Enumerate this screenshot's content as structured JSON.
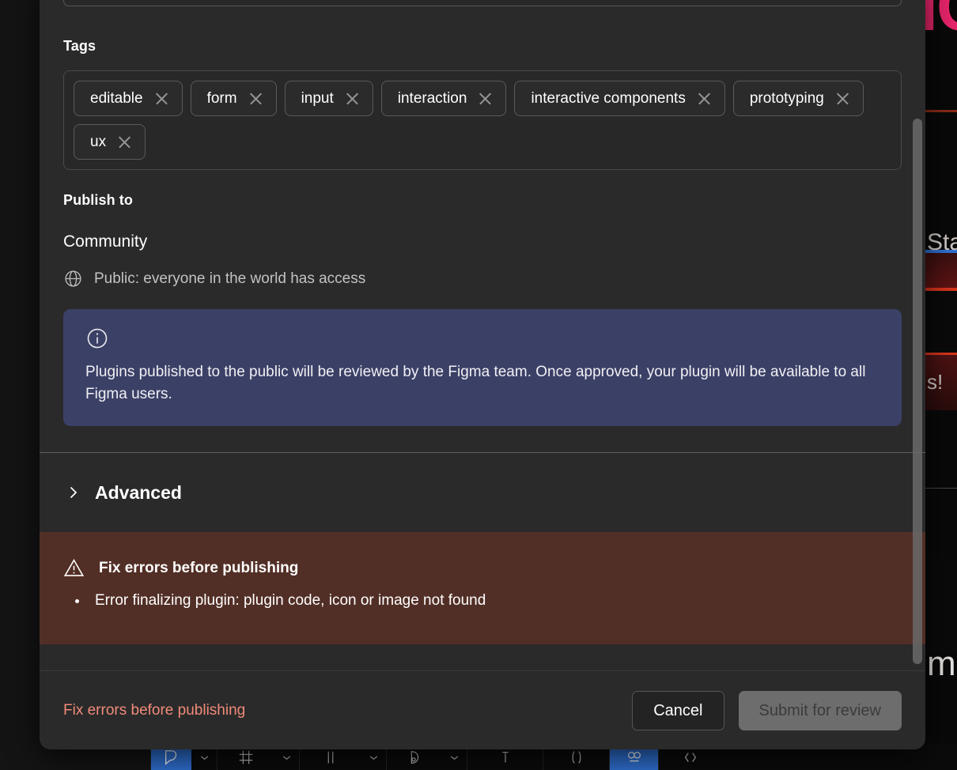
{
  "modal": {
    "tags": {
      "label": "Tags",
      "items": [
        {
          "name": "editable"
        },
        {
          "name": "form"
        },
        {
          "name": "input"
        },
        {
          "name": "interaction"
        },
        {
          "name": "interactive components"
        },
        {
          "name": "prototyping"
        },
        {
          "name": "ux"
        }
      ],
      "remove_icon": "close-x-icon"
    },
    "publish_to": {
      "label": "Publish to",
      "destination": "Community",
      "visibility_icon": "globe-icon",
      "visibility": "Public: everyone in the world has access"
    },
    "info_banner": {
      "icon": "info-circle-icon",
      "text": "Plugins published to the public will be reviewed by the Figma team. Once approved, your plugin will be available to all Figma users.",
      "bg_color": "#3b4066",
      "text_color": "#f0f0f4"
    },
    "advanced": {
      "label": "Advanced",
      "chevron_icon": "chevron-right-icon",
      "expanded": false
    },
    "error_banner": {
      "icon": "warning-triangle-icon",
      "title": "Fix errors before publishing",
      "errors": [
        "Error finalizing plugin: plugin code, icon or image not found"
      ],
      "bg_color": "#522f26"
    },
    "footer": {
      "error_text": "Fix errors before publishing",
      "error_color": "#f08b7a",
      "cancel_label": "Cancel",
      "submit_label": "Submit for review",
      "submit_disabled": true
    },
    "scrollbar": {
      "name": "vertical-scrollbar"
    }
  },
  "background": {
    "pink_text": "IC",
    "state_text": "Stat",
    "excl_text": "s!",
    "mm_text": "mm",
    "toolbar": {
      "tools": [
        {
          "icon": "pen-tool-icon",
          "selected": true,
          "has_chevron": true
        },
        {
          "icon": "frame-icon",
          "selected": false,
          "has_chevron": true
        },
        {
          "icon": "slice-icon",
          "selected": false,
          "has_chevron": true
        },
        {
          "icon": "shape-icon",
          "selected": false,
          "has_chevron": true
        },
        {
          "icon": "text-icon",
          "selected": false,
          "has_chevron": false
        },
        {
          "icon": "component-icon",
          "selected": false,
          "has_chevron": false
        },
        {
          "icon": "mask-icon",
          "selected": true,
          "has_chevron": false
        },
        {
          "icon": "code-icon",
          "selected": false,
          "has_chevron": false
        }
      ]
    }
  }
}
